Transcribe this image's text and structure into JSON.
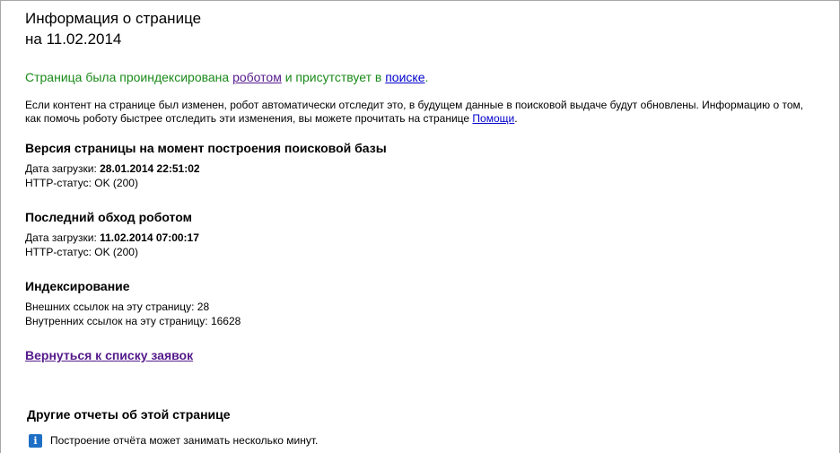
{
  "header": {
    "title_line1": "Информация о странице",
    "title_line2": "на 11.02.2014"
  },
  "indexed": {
    "prefix": "Страница была проиндексирована ",
    "robot_link": "роботом",
    "middle": " и присутствует в ",
    "search_link": "поиске",
    "suffix": "."
  },
  "info": {
    "text": "Если контент на странице был изменен, робот автоматически отследит это, в будущем данные в поисковой выдаче будут обновлены. Информацию о том, как помочь роботу быстрее отследить эти изменения, вы можете прочитать на странице ",
    "help_link": "Помощи",
    "suffix": "."
  },
  "version": {
    "heading": "Версия страницы на момент построения поисковой базы",
    "download_label": "Дата загрузки: ",
    "download_value": "28.01.2014 22:51:02",
    "http_status": "HTTP-статус: OK (200)"
  },
  "last_crawl": {
    "heading": "Последний обход роботом",
    "download_label": "Дата загрузки: ",
    "download_value": "11.02.2014 07:00:17",
    "http_status": "HTTP-статус: OK (200)"
  },
  "indexing": {
    "heading": "Индексирование",
    "external_links": "Внешних ссылок на эту страницу: 28",
    "internal_links": "Внутренних ссылок на эту страницу: 16628"
  },
  "back_link": "Вернуться к списку заявок",
  "other_reports": {
    "heading": "Другие отчеты об этой странице",
    "notice": "Построение отчёта может занимать несколько минут.",
    "icon_glyph": "i"
  },
  "colors": {
    "green_text": "#1a8a1a",
    "visited_link": "#551a8b",
    "link": "#0000cc",
    "info_icon": "#1f6fc5"
  }
}
